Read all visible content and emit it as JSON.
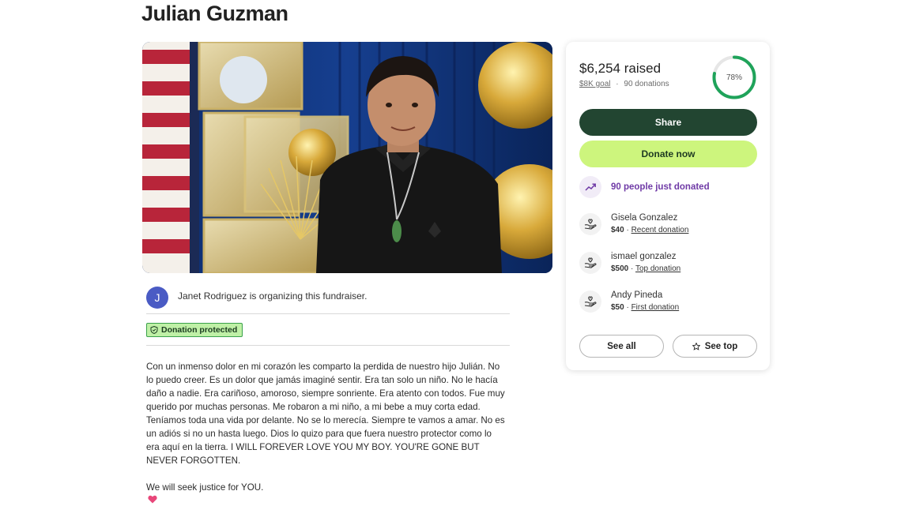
{
  "page": {
    "title": "Julian Guzman"
  },
  "organizer": {
    "avatar_initial": "J",
    "text": "Janet Rodriguez is organizing this fundraiser."
  },
  "badge": {
    "label": "Donation protected",
    "icon": "shield-icon"
  },
  "story": {
    "paragraph_1": "Con un inmenso dolor en mi corazón les comparto la perdida de nuestro hijo Julián. No lo puedo creer. Es un dolor que jamás imaginé sentir. Era tan solo un niño. No le hacía daño a nadie. Era cariñoso, amoroso, siempre sonriente. Era atento con todos. Fue muy querido por muchas personas. Me robaron a mi niño, a mi bebe a muy corta edad. Teníamos toda una vida por delante. No se lo merecía. Siempre te vamos a amar. No es un adiós si no un hasta luego. Dios lo quizo para que fuera nuestro protector como lo era aquí en la tierra. I WILL FOREVER LOVE YOU MY BOY. YOU'RE GONE BUT NEVER FORGOTTEN.",
    "paragraph_2": "We will seek justice for YOU."
  },
  "donation_card": {
    "raised": "$6,254 raised",
    "goal": "$8K goal",
    "separator": "·",
    "donations": "90 donations",
    "progress_percent": 78,
    "progress_label": "78%",
    "share_label": "Share",
    "donate_label": "Donate now",
    "recent_activity": "90 people just donated",
    "donors": [
      {
        "name": "Gisela Gonzalez",
        "amount": "$40",
        "tag": "Recent donation"
      },
      {
        "name": "ismael gonzalez",
        "amount": "$500",
        "tag": "Top donation"
      },
      {
        "name": "Andy Pineda",
        "amount": "$50",
        "tag": "First donation"
      }
    ],
    "see_all_label": "See all",
    "see_top_label": "See top"
  },
  "colors": {
    "share_bg": "#224531",
    "donate_bg": "#cdf57d",
    "progress": "#1fa35a",
    "recent_text": "#6f3aa6",
    "badge_bg": "#bff0a6",
    "avatar_bg": "#4a5bc4"
  }
}
